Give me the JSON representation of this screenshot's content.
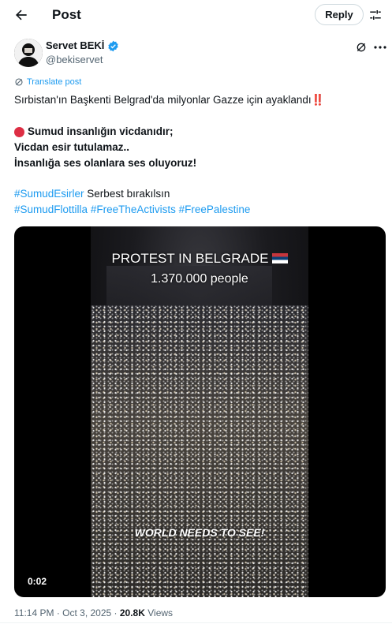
{
  "header": {
    "title": "Post",
    "reply_label": "Reply",
    "icons": {
      "back": "arrow-left-icon",
      "filter": "sliders-icon"
    }
  },
  "author": {
    "name": "Servet BEKİ",
    "handle": "@bekiservet",
    "verified": true,
    "verified_color": "#1d9bf0",
    "avatar": "avatar-photo"
  },
  "actions": {
    "icons": [
      "grok-icon",
      "more-icon"
    ]
  },
  "translate_label": "Translate post",
  "tweet": {
    "line1": "Sırbistan'ın Başkenti Belgrad'da milyonlar Gazze için ayaklandı",
    "line1_emoji": "‼️",
    "line2": "Sumud insanlığın vicdanıdır;",
    "line3": "Vicdan esir tutulamaz..",
    "line4": "İnsanlığa ses olanlara ses oluyoruz!",
    "line5_hashtag": "#SumudEsirler",
    "line5_text": " Serbest bırakılsın",
    "hashtags": [
      "#SumudFlottilla",
      "#FreeTheActivists",
      "#FreePalestine"
    ]
  },
  "media": {
    "overlay_title": "PROTEST IN BELGRADE",
    "overlay_count": "1.370.000 people",
    "overlay_bottom": "WORLD NEEDS TO SEE!",
    "duration": "0:02"
  },
  "meta": {
    "time": "11:14 PM",
    "separator": " · ",
    "date": "Oct 3, 2025",
    "views_count": "20.8K",
    "views_label": " Views"
  },
  "colors": {
    "accent": "#1d9bf0",
    "text": "#0f1419",
    "muted": "#536471",
    "alert_red": "#dd2e44"
  }
}
